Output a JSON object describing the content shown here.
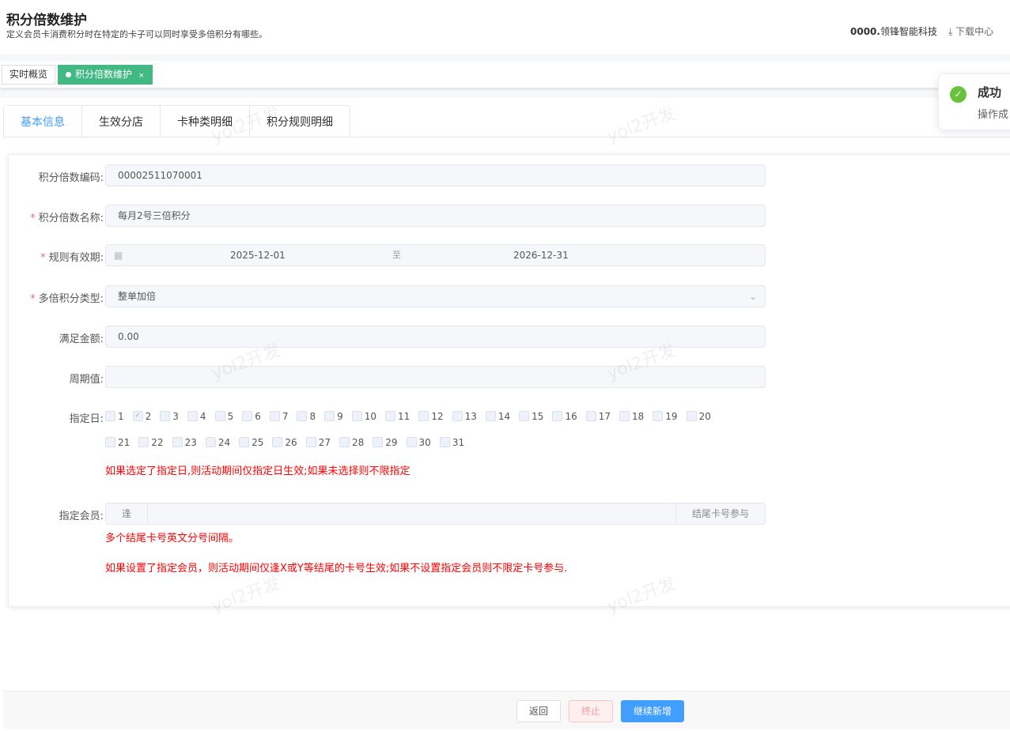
{
  "header": {
    "title": "积分倍数维护",
    "subtitle": "定义会员卡消费积分时在特定的卡子可以同时享受多倍积分有哪些。",
    "company_code": "0000.",
    "company_name": "领锋智能科技",
    "download": "下载中心"
  },
  "page_tabs": [
    {
      "label": "实时概览"
    },
    {
      "label": "积分倍数维护",
      "close": "×"
    }
  ],
  "tabs": [
    "基本信息",
    "生效分店",
    "卡种类明细",
    "积分规则明细"
  ],
  "form": {
    "code": {
      "label": "积分倍数编码:",
      "value": "00002511070001"
    },
    "name": {
      "label": "积分倍数名称:",
      "value": "每月2号三倍积分",
      "required": "*"
    },
    "period": {
      "label": "规则有效期:",
      "start": "2025-12-01",
      "sep": "至",
      "end": "2026-12-31",
      "required": "*"
    },
    "type": {
      "label": "多倍积分类型:",
      "value": "整单加倍",
      "required": "*"
    },
    "amount": {
      "label": "满足金额:",
      "value": "0.00"
    },
    "cycle": {
      "label": "周期值:",
      "value": ""
    },
    "days": {
      "label": "指定日:",
      "checked": [
        2
      ],
      "hint": "如果选定了指定日,则活动期间仅指定日生效;如果未选择则不限指定"
    },
    "member": {
      "label": "指定会员:",
      "prefix": "逢",
      "value": "",
      "suffix": "结尾卡号参与",
      "hint1": "多个结尾卡号英文分号间隔。",
      "hint2": "如果设置了指定会员，则活动期间仅逢X或Y等结尾的卡号生效;如果不设置指定会员则不限定卡号参与."
    }
  },
  "footer": {
    "back": "返回",
    "stop": "终止",
    "continue": "继续新增"
  },
  "toast": {
    "title": "成功",
    "message": "操作成"
  },
  "watermark": "yol2开发",
  "colors": {
    "accent": "#409eff",
    "tag": "#42b983",
    "danger": "#f56c6c",
    "success": "#67c23a"
  }
}
